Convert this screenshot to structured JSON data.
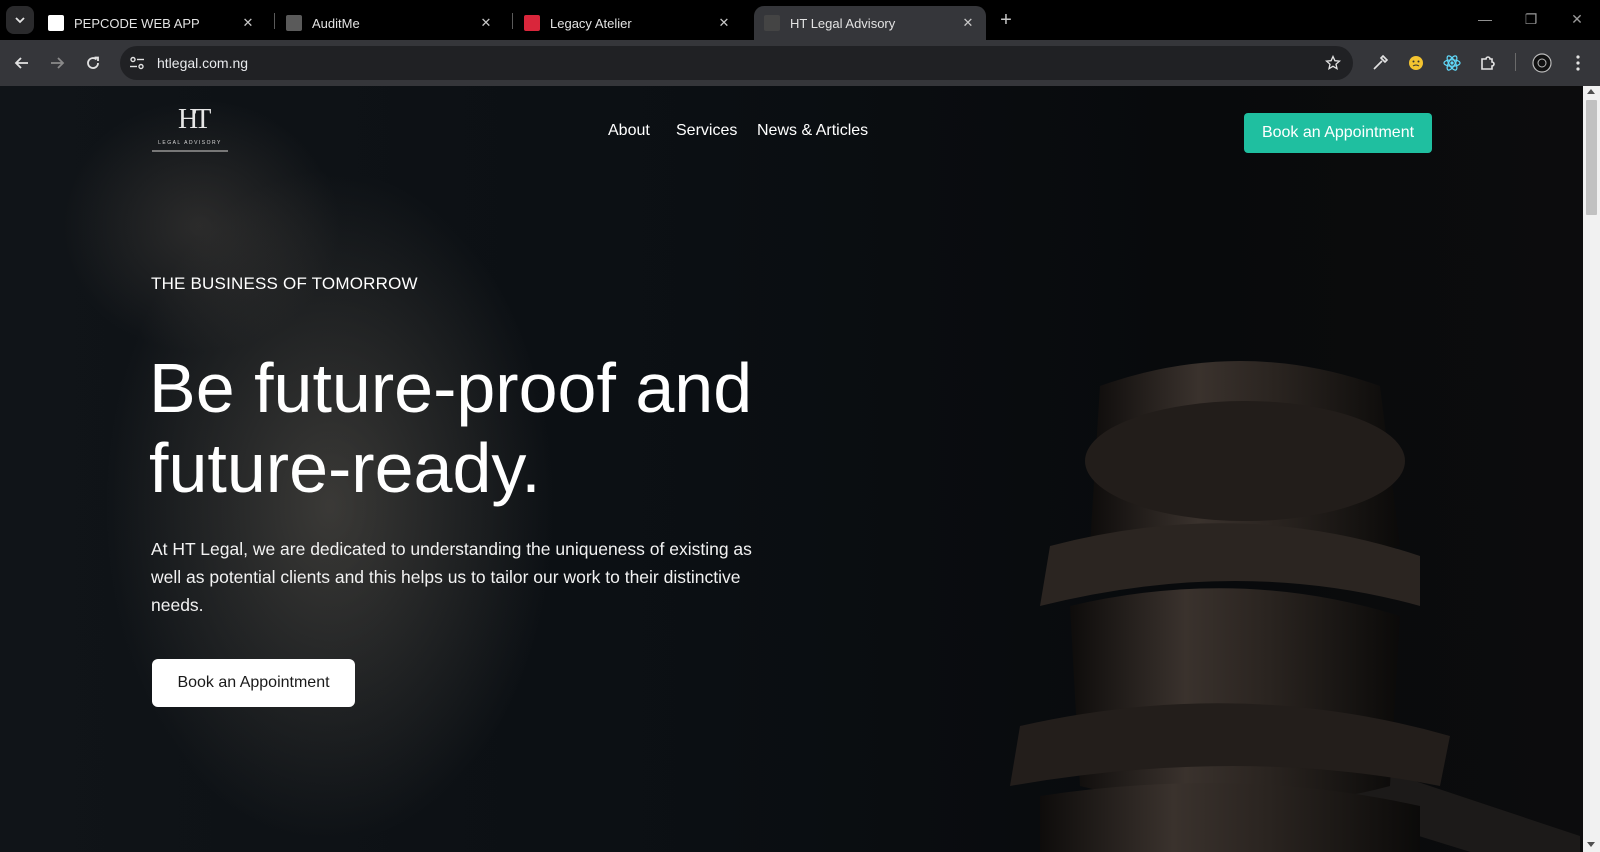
{
  "browser": {
    "tabs": [
      {
        "title": "PEPCODE WEB APP",
        "favicon_color": "#ffffff",
        "active": false
      },
      {
        "title": "AuditMe",
        "favicon_color": "#5a5a5a",
        "active": false
      },
      {
        "title": "Legacy Atelier",
        "favicon_color": "#d9263b",
        "active": false
      },
      {
        "title": "HT Legal Advisory",
        "favicon_color": "#444444",
        "active": true
      }
    ],
    "close_glyph": "✕",
    "new_tab_glyph": "+",
    "url": "htlegal.com.ng",
    "window_controls": {
      "minimize": "—",
      "restore": "❐",
      "close": "✕"
    },
    "icons": [
      "tab-search-icon",
      "back-icon",
      "forward-icon",
      "reload-icon",
      "site-info-icon",
      "bookmark-star-icon",
      "eyedropper-extension-icon",
      "emoji-extension-icon",
      "react-devtools-icon",
      "extensions-puzzle-icon",
      "profile-avatar-icon",
      "menu-kebab-icon"
    ]
  },
  "site": {
    "logo": {
      "mark": "HT",
      "text": "LEGAL ADVISORY"
    },
    "nav": [
      {
        "label": "About"
      },
      {
        "label": "Services"
      },
      {
        "label": "News & Articles"
      }
    ],
    "header_cta": "Book an Appointment",
    "hero": {
      "eyebrow": "THE BUSINESS OF TOMORROW",
      "headline_line1": "Be future-proof and",
      "headline_line2": "future-ready.",
      "lede": "At HT Legal, we are dedicated to understanding the uniqueness of existing as well as potential clients and this helps us to tailor our work to their distinctive needs.",
      "cta": "Book an Appointment"
    },
    "colors": {
      "accent": "#1fbfa0",
      "background": "#0b0f13",
      "text": "#ffffff"
    }
  }
}
